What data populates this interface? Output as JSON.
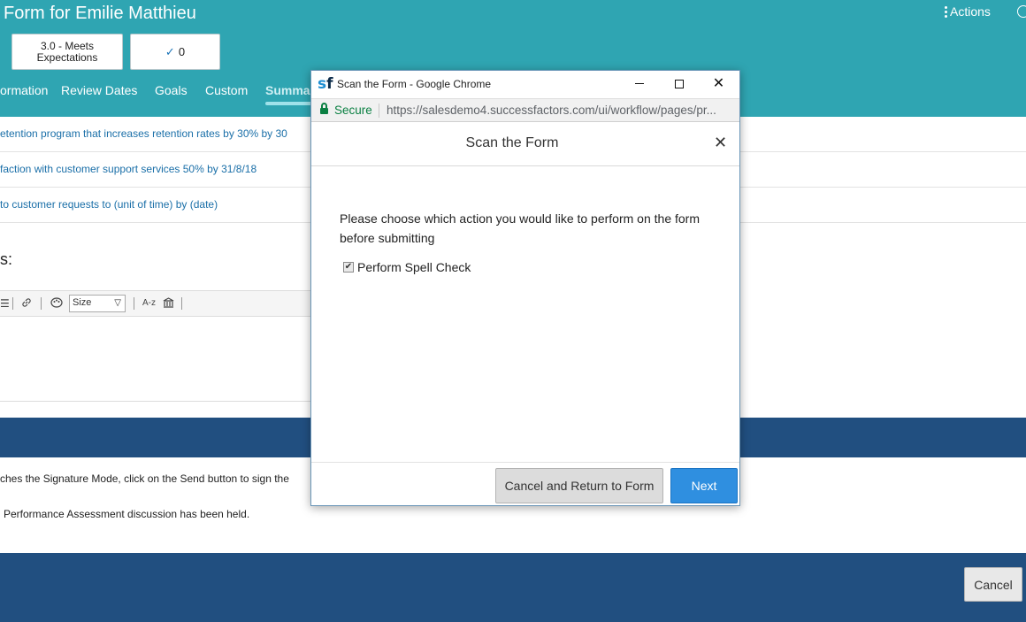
{
  "page": {
    "form_title": "Form for Emilie Matthieu",
    "actions_label": "Actions",
    "rating": {
      "line1": "3.0 - Meets",
      "line2": "Expectations"
    },
    "completed_count": "0",
    "tabs": [
      "ormation",
      "Review Dates",
      "Goals",
      "Custom",
      "Summa"
    ],
    "goals": [
      "etention program that increases retention rates by 30% by 30",
      "faction with customer support services 50% by 31/8/18",
      "to customer requests to (unit of time) by (date)"
    ],
    "section_label": "s:",
    "toolbar": {
      "size_label": "Size",
      "sort_label": "A-z"
    },
    "instructions": [
      "ches the Signature Mode, click on the Send button to sign the",
      "Performance Assessment discussion has been held."
    ],
    "cancel_label": "Cancel"
  },
  "popup": {
    "window_title": "Scan the Form - Google Chrome",
    "logo": {
      "s": "s",
      "f": "f"
    },
    "secure_label": "Secure",
    "url": "https://salesdemo4.successfactors.com/ui/workflow/pages/pr...",
    "dialog_title": "Scan the Form",
    "prompt": "Please choose which action you would like to perform on the form before submitting",
    "checkbox_label": "Perform Spell Check",
    "checkbox_checked": true,
    "cancel_return_label": "Cancel and Return to Form",
    "next_label": "Next"
  },
  "colors": {
    "header_teal": "#2fa5b2",
    "band_navy": "#214f80",
    "next_blue": "#2f8fe0",
    "link_blue": "#1a6fa8",
    "secure_green": "#0b8043"
  },
  "icons": [
    "kebab-menu-icon",
    "clock-icon",
    "checkmark-icon",
    "list-icon",
    "link-icon",
    "palette-icon",
    "spellcheck-icon",
    "lock-icon",
    "minimize-icon",
    "maximize-icon",
    "close-icon"
  ]
}
